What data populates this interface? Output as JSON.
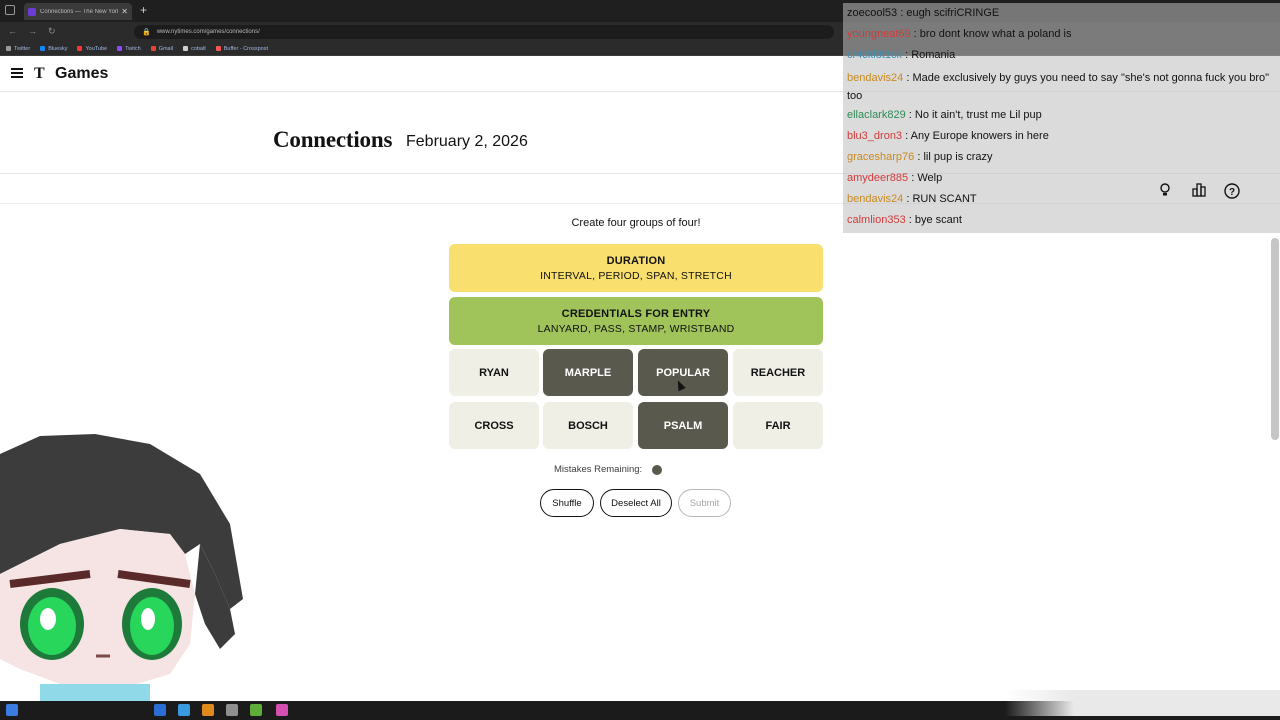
{
  "browser": {
    "tab_title": "Connections — The New York",
    "new_tab": "+",
    "url": "www.nytimes.com/games/connections/",
    "bookmarks": [
      "Twitter",
      "Bluesky",
      "YouTube",
      "Twitch",
      "Gmail",
      "cobalt",
      "Buffer - Crosspost"
    ]
  },
  "site": {
    "logo_mark": "T",
    "logo_text": "Games"
  },
  "game": {
    "title": "Connections",
    "date": "February 2, 2026",
    "instructions": "Create four groups of four!",
    "solved": [
      {
        "category": "DURATION",
        "words": "INTERVAL, PERIOD, SPAN, STRETCH",
        "color": "#f9df6d"
      },
      {
        "category": "CREDENTIALS FOR ENTRY",
        "words": "LANYARD, PASS, STAMP, WRISTBAND",
        "color": "#a0c35a"
      }
    ],
    "tiles": [
      {
        "word": "RYAN",
        "selected": false
      },
      {
        "word": "MARPLE",
        "selected": true
      },
      {
        "word": "POPULAR",
        "selected": true
      },
      {
        "word": "REACHER",
        "selected": false
      },
      {
        "word": "CROSS",
        "selected": false
      },
      {
        "word": "BOSCH",
        "selected": false
      },
      {
        "word": "PSALM",
        "selected": true
      },
      {
        "word": "FAIR",
        "selected": false
      }
    ],
    "mistakes_label": "Mistakes Remaining:",
    "mistakes_remaining": 1,
    "buttons": {
      "shuffle": "Shuffle",
      "deselect": "Deselect All",
      "submit": "Submit"
    }
  },
  "chat": {
    "messages": [
      {
        "user": "zoecool53",
        "text": "eugh scifriCRINGE",
        "color": "#121212"
      },
      {
        "user": "youngneat69",
        "text": "bro dont know what a poland is",
        "color": "#d33a3a"
      },
      {
        "user": "cr4ckl3t1ck",
        "text": "Romania",
        "color": "#3a8fb5"
      },
      {
        "user": "bendavis24",
        "text": "Made exclusively by guys you need to say \"she's not gonna fuck you bro\" too",
        "color": "#c98a1e"
      },
      {
        "user": "ellaclark829",
        "text": "No it ain't, trust me Lil pup",
        "color": "#2e8b57"
      },
      {
        "user": "blu3_dron3",
        "text": "Any Europe knowers in here",
        "color": "#d33a3a"
      },
      {
        "user": "gracesharp76",
        "text": "lil pup is crazy",
        "color": "#c98a1e"
      },
      {
        "user": "amydeer885",
        "text": "Welp",
        "color": "#d33a3a"
      },
      {
        "user": "bendavis24",
        "text": "RUN SCANT",
        "color": "#c98a1e"
      },
      {
        "user": "calmlion353",
        "text": "bye scant",
        "color": "#d33a3a"
      }
    ]
  },
  "icons": {
    "hint": "lightbulb-icon",
    "stats": "stats-icon",
    "help": "help-icon"
  }
}
